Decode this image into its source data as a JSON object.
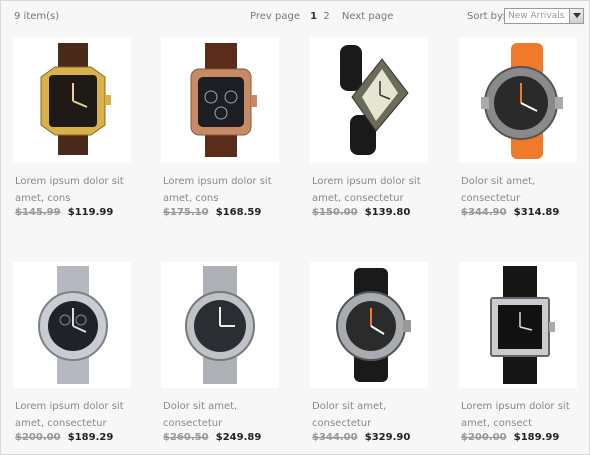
{
  "toolbar": {
    "item_count": "9 item(s)",
    "prev_label": "Prev page",
    "pages": [
      "1",
      "2"
    ],
    "next_label": "Next page",
    "sort_label": "Sort by:",
    "sort_value": "New Arrivals"
  },
  "products": [
    {
      "title": "Lorem ipsum dolor sit amet, cons",
      "old_price": "$145.99",
      "new_price": "$119.99"
    },
    {
      "title": "Lorem ipsum dolor sit amet, cons",
      "old_price": "$175.10",
      "new_price": "$168.59"
    },
    {
      "title": "Lorem ipsum dolor sit amet, consectetur",
      "old_price": "$150.00",
      "new_price": "$139.80"
    },
    {
      "title": "Dolor sit amet, consectetur",
      "old_price": "$344.90",
      "new_price": "$314.89"
    },
    {
      "title": "Lorem ipsum dolor sit amet, consectetur",
      "old_price": "$200.00",
      "new_price": "$189.29"
    },
    {
      "title": "Dolor sit amet, consectetur",
      "old_price": "$260.50",
      "new_price": "$249.89"
    },
    {
      "title": "Dolor sit amet, consectetur",
      "old_price": "$344.00",
      "new_price": "$329.90"
    },
    {
      "title": "Lorem ipsum dolor sit amet, consect",
      "old_price": "$200.00",
      "new_price": "$189.99"
    }
  ]
}
